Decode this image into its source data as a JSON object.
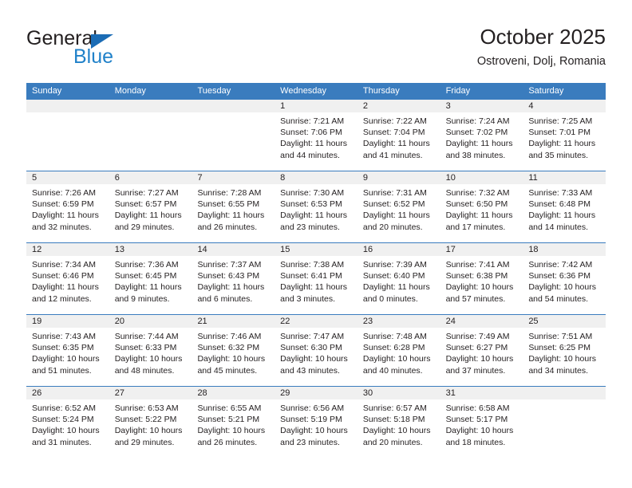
{
  "logo": {
    "word_one": "General",
    "word_two": "Blue",
    "triangle_color": "#1b6cb5",
    "blue_color": "#2081c9"
  },
  "header": {
    "title": "October 2025",
    "subtitle": "Ostroveni, Dolj, Romania"
  },
  "theme": {
    "header_bg": "#3a7cbe",
    "daynum_bg": "#f0f0f0",
    "text": "#231f20"
  },
  "calendar": {
    "weekday_headers": [
      "Sunday",
      "Monday",
      "Tuesday",
      "Wednesday",
      "Thursday",
      "Friday",
      "Saturday"
    ],
    "weeks": [
      [
        {
          "day": "",
          "empty": true
        },
        {
          "day": "",
          "empty": true
        },
        {
          "day": "",
          "empty": true
        },
        {
          "day": "1",
          "sunrise": "Sunrise: 7:21 AM",
          "sunset": "Sunset: 7:06 PM",
          "daylight1": "Daylight: 11 hours",
          "daylight2": "and 44 minutes."
        },
        {
          "day": "2",
          "sunrise": "Sunrise: 7:22 AM",
          "sunset": "Sunset: 7:04 PM",
          "daylight1": "Daylight: 11 hours",
          "daylight2": "and 41 minutes."
        },
        {
          "day": "3",
          "sunrise": "Sunrise: 7:24 AM",
          "sunset": "Sunset: 7:02 PM",
          "daylight1": "Daylight: 11 hours",
          "daylight2": "and 38 minutes."
        },
        {
          "day": "4",
          "sunrise": "Sunrise: 7:25 AM",
          "sunset": "Sunset: 7:01 PM",
          "daylight1": "Daylight: 11 hours",
          "daylight2": "and 35 minutes."
        }
      ],
      [
        {
          "day": "5",
          "sunrise": "Sunrise: 7:26 AM",
          "sunset": "Sunset: 6:59 PM",
          "daylight1": "Daylight: 11 hours",
          "daylight2": "and 32 minutes."
        },
        {
          "day": "6",
          "sunrise": "Sunrise: 7:27 AM",
          "sunset": "Sunset: 6:57 PM",
          "daylight1": "Daylight: 11 hours",
          "daylight2": "and 29 minutes."
        },
        {
          "day": "7",
          "sunrise": "Sunrise: 7:28 AM",
          "sunset": "Sunset: 6:55 PM",
          "daylight1": "Daylight: 11 hours",
          "daylight2": "and 26 minutes."
        },
        {
          "day": "8",
          "sunrise": "Sunrise: 7:30 AM",
          "sunset": "Sunset: 6:53 PM",
          "daylight1": "Daylight: 11 hours",
          "daylight2": "and 23 minutes."
        },
        {
          "day": "9",
          "sunrise": "Sunrise: 7:31 AM",
          "sunset": "Sunset: 6:52 PM",
          "daylight1": "Daylight: 11 hours",
          "daylight2": "and 20 minutes."
        },
        {
          "day": "10",
          "sunrise": "Sunrise: 7:32 AM",
          "sunset": "Sunset: 6:50 PM",
          "daylight1": "Daylight: 11 hours",
          "daylight2": "and 17 minutes."
        },
        {
          "day": "11",
          "sunrise": "Sunrise: 7:33 AM",
          "sunset": "Sunset: 6:48 PM",
          "daylight1": "Daylight: 11 hours",
          "daylight2": "and 14 minutes."
        }
      ],
      [
        {
          "day": "12",
          "sunrise": "Sunrise: 7:34 AM",
          "sunset": "Sunset: 6:46 PM",
          "daylight1": "Daylight: 11 hours",
          "daylight2": "and 12 minutes."
        },
        {
          "day": "13",
          "sunrise": "Sunrise: 7:36 AM",
          "sunset": "Sunset: 6:45 PM",
          "daylight1": "Daylight: 11 hours",
          "daylight2": "and 9 minutes."
        },
        {
          "day": "14",
          "sunrise": "Sunrise: 7:37 AM",
          "sunset": "Sunset: 6:43 PM",
          "daylight1": "Daylight: 11 hours",
          "daylight2": "and 6 minutes."
        },
        {
          "day": "15",
          "sunrise": "Sunrise: 7:38 AM",
          "sunset": "Sunset: 6:41 PM",
          "daylight1": "Daylight: 11 hours",
          "daylight2": "and 3 minutes."
        },
        {
          "day": "16",
          "sunrise": "Sunrise: 7:39 AM",
          "sunset": "Sunset: 6:40 PM",
          "daylight1": "Daylight: 11 hours",
          "daylight2": "and 0 minutes."
        },
        {
          "day": "17",
          "sunrise": "Sunrise: 7:41 AM",
          "sunset": "Sunset: 6:38 PM",
          "daylight1": "Daylight: 10 hours",
          "daylight2": "and 57 minutes."
        },
        {
          "day": "18",
          "sunrise": "Sunrise: 7:42 AM",
          "sunset": "Sunset: 6:36 PM",
          "daylight1": "Daylight: 10 hours",
          "daylight2": "and 54 minutes."
        }
      ],
      [
        {
          "day": "19",
          "sunrise": "Sunrise: 7:43 AM",
          "sunset": "Sunset: 6:35 PM",
          "daylight1": "Daylight: 10 hours",
          "daylight2": "and 51 minutes."
        },
        {
          "day": "20",
          "sunrise": "Sunrise: 7:44 AM",
          "sunset": "Sunset: 6:33 PM",
          "daylight1": "Daylight: 10 hours",
          "daylight2": "and 48 minutes."
        },
        {
          "day": "21",
          "sunrise": "Sunrise: 7:46 AM",
          "sunset": "Sunset: 6:32 PM",
          "daylight1": "Daylight: 10 hours",
          "daylight2": "and 45 minutes."
        },
        {
          "day": "22",
          "sunrise": "Sunrise: 7:47 AM",
          "sunset": "Sunset: 6:30 PM",
          "daylight1": "Daylight: 10 hours",
          "daylight2": "and 43 minutes."
        },
        {
          "day": "23",
          "sunrise": "Sunrise: 7:48 AM",
          "sunset": "Sunset: 6:28 PM",
          "daylight1": "Daylight: 10 hours",
          "daylight2": "and 40 minutes."
        },
        {
          "day": "24",
          "sunrise": "Sunrise: 7:49 AM",
          "sunset": "Sunset: 6:27 PM",
          "daylight1": "Daylight: 10 hours",
          "daylight2": "and 37 minutes."
        },
        {
          "day": "25",
          "sunrise": "Sunrise: 7:51 AM",
          "sunset": "Sunset: 6:25 PM",
          "daylight1": "Daylight: 10 hours",
          "daylight2": "and 34 minutes."
        }
      ],
      [
        {
          "day": "26",
          "sunrise": "Sunrise: 6:52 AM",
          "sunset": "Sunset: 5:24 PM",
          "daylight1": "Daylight: 10 hours",
          "daylight2": "and 31 minutes."
        },
        {
          "day": "27",
          "sunrise": "Sunrise: 6:53 AM",
          "sunset": "Sunset: 5:22 PM",
          "daylight1": "Daylight: 10 hours",
          "daylight2": "and 29 minutes."
        },
        {
          "day": "28",
          "sunrise": "Sunrise: 6:55 AM",
          "sunset": "Sunset: 5:21 PM",
          "daylight1": "Daylight: 10 hours",
          "daylight2": "and 26 minutes."
        },
        {
          "day": "29",
          "sunrise": "Sunrise: 6:56 AM",
          "sunset": "Sunset: 5:19 PM",
          "daylight1": "Daylight: 10 hours",
          "daylight2": "and 23 minutes."
        },
        {
          "day": "30",
          "sunrise": "Sunrise: 6:57 AM",
          "sunset": "Sunset: 5:18 PM",
          "daylight1": "Daylight: 10 hours",
          "daylight2": "and 20 minutes."
        },
        {
          "day": "31",
          "sunrise": "Sunrise: 6:58 AM",
          "sunset": "Sunset: 5:17 PM",
          "daylight1": "Daylight: 10 hours",
          "daylight2": "and 18 minutes."
        },
        {
          "day": "",
          "empty": true
        }
      ]
    ]
  }
}
